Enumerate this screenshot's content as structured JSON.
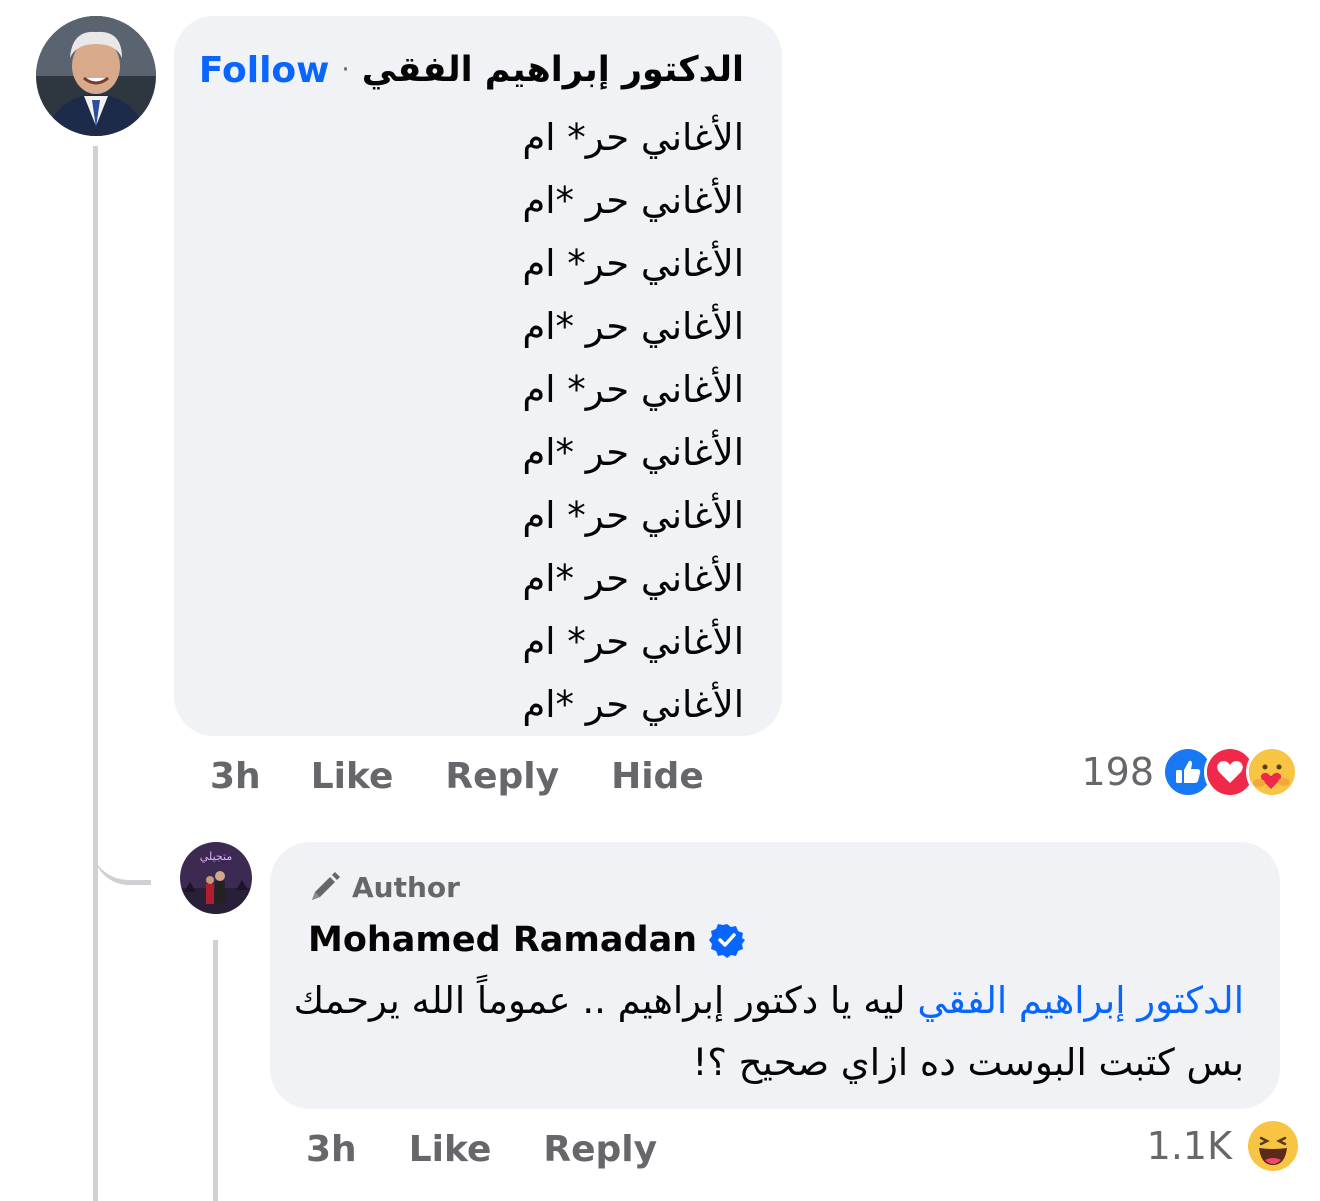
{
  "comment1": {
    "author_name": "الدكتور  إبراهيم  الفقي",
    "separator": "·",
    "follow_label": "Follow",
    "lines": [
      "الأغاني حر* ام",
      "الأغاني حر *ام",
      "الأغاني حر* ام",
      "الأغاني حر *ام",
      "الأغاني حر* ام",
      "الأغاني حر *ام",
      "الأغاني حر* ام",
      "الأغاني حر *ام",
      "الأغاني حر* ام",
      "الأغاني حر *ام"
    ],
    "time": "3h",
    "like_label": "Like",
    "reply_label": "Reply",
    "hide_label": "Hide",
    "reaction_count": "198",
    "reaction_icons": [
      "like-reaction-icon",
      "love-reaction-icon",
      "care-reaction-icon"
    ]
  },
  "comment2": {
    "author_badge": "Author",
    "author_name": "Mohamed Ramadan",
    "mention": "الدكتور إبراهيم الفقي",
    "text": " ليه يا دكتور إبراهيم .. عموماً الله يرحمك بس كتبت البوست ده ازاي صحيح ؟!",
    "time": "3h",
    "like_label": "Like",
    "reply_label": "Reply",
    "reaction_count": "1.1K",
    "reaction_icons": [
      "haha-reaction-icon"
    ]
  },
  "colors": {
    "bubble": "#f0f2f5",
    "link_blue": "#0866ff",
    "meta_gray": "#65676b",
    "thread_line": "#ced0d4"
  }
}
